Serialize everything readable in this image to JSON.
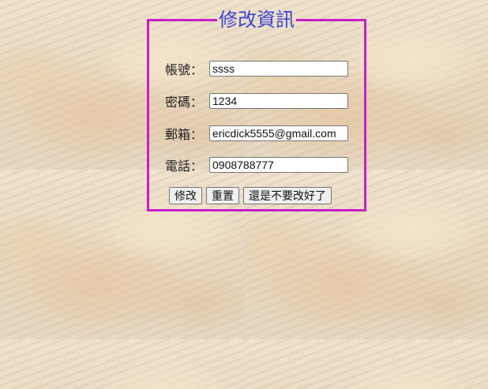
{
  "form": {
    "title": "修改資訊",
    "fields": [
      {
        "label": "帳號：",
        "value": "ssss"
      },
      {
        "label": "密碼：",
        "value": "1234"
      },
      {
        "label": "郵箱：",
        "value": "ericdick5555@gmail.com"
      },
      {
        "label": "電話：",
        "value": "0908788777"
      }
    ],
    "buttons": {
      "submit_label": "修改",
      "reset_label": "重置",
      "cancel_label": "還是不要改好了"
    }
  },
  "colors": {
    "border": "#c81ec8",
    "title": "#3b45d6"
  }
}
